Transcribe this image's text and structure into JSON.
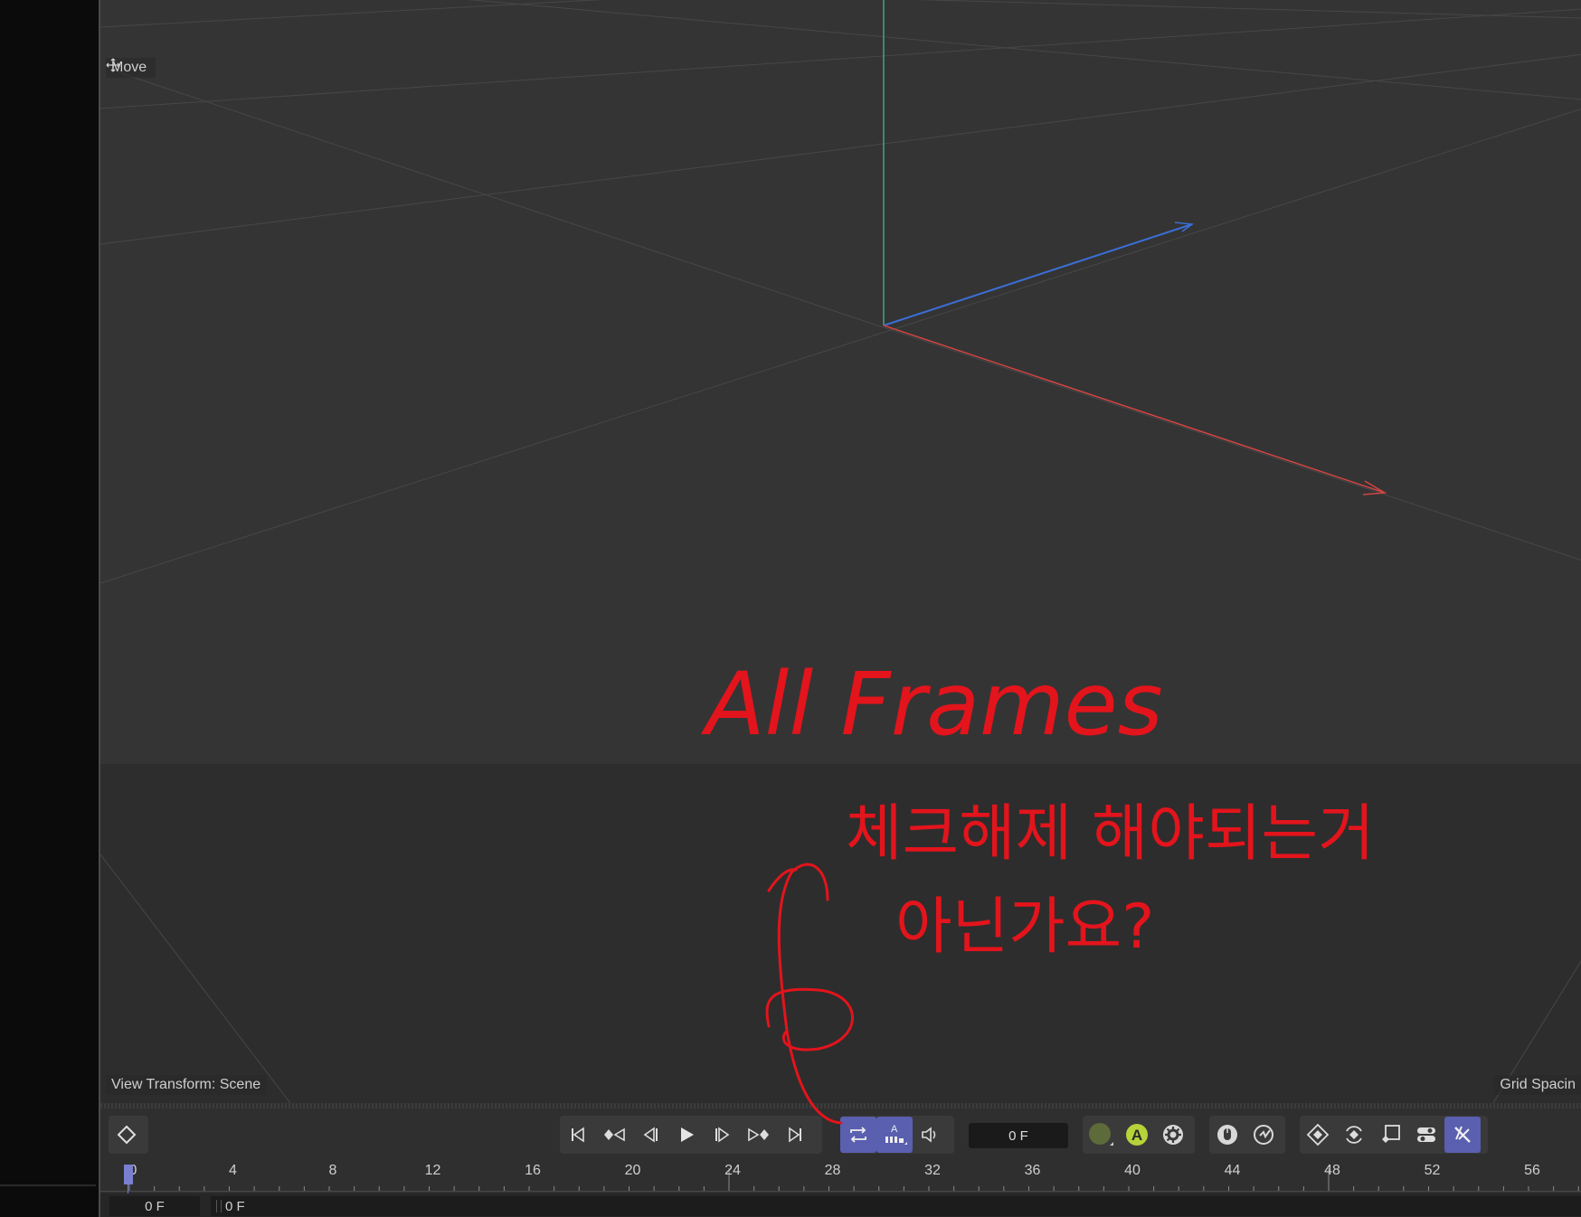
{
  "viewport": {
    "tool_label": "Move",
    "view_transform": "View Transform: Scene",
    "grid_spacing": "Grid Spacin"
  },
  "timeline": {
    "current_frame": "0 F",
    "start_frame": "0 F",
    "end_frame": "0 F",
    "ruler_ticks": [
      "0",
      "4",
      "8",
      "12",
      "16",
      "20",
      "24",
      "28",
      "32",
      "36",
      "40",
      "44",
      "48",
      "52",
      "56"
    ],
    "transport_buttons": [
      {
        "name": "go-to-start",
        "icon": "skip-start-icon"
      },
      {
        "name": "previous-key",
        "icon": "prev-key-icon"
      },
      {
        "name": "previous-frame",
        "icon": "prev-frame-icon"
      },
      {
        "name": "play",
        "icon": "play-icon"
      },
      {
        "name": "next-frame",
        "icon": "next-frame-icon"
      },
      {
        "name": "next-key",
        "icon": "next-key-icon"
      },
      {
        "name": "go-to-end",
        "icon": "skip-end-icon"
      }
    ],
    "loop_group": [
      {
        "name": "loop",
        "icon": "loop-icon",
        "active": true
      },
      {
        "name": "all-frames",
        "icon": "all-frames-icon",
        "active": true,
        "label": "A"
      },
      {
        "name": "sound",
        "icon": "sound-icon",
        "active": false
      }
    ],
    "record_group": [
      {
        "name": "record",
        "icon": "record-icon"
      },
      {
        "name": "autokey",
        "icon": "autokey-icon",
        "label": "A"
      },
      {
        "name": "key-settings",
        "icon": "gear-icon"
      }
    ],
    "colors": {
      "active": "#5a5fb0",
      "record": "#5d6a3a",
      "autokey": "#b6d33a"
    }
  },
  "annotation": {
    "line1": "All Frames",
    "line2": "체크해제 해야되는거",
    "line3": "아닌가요?",
    "color": "#e3141c"
  }
}
